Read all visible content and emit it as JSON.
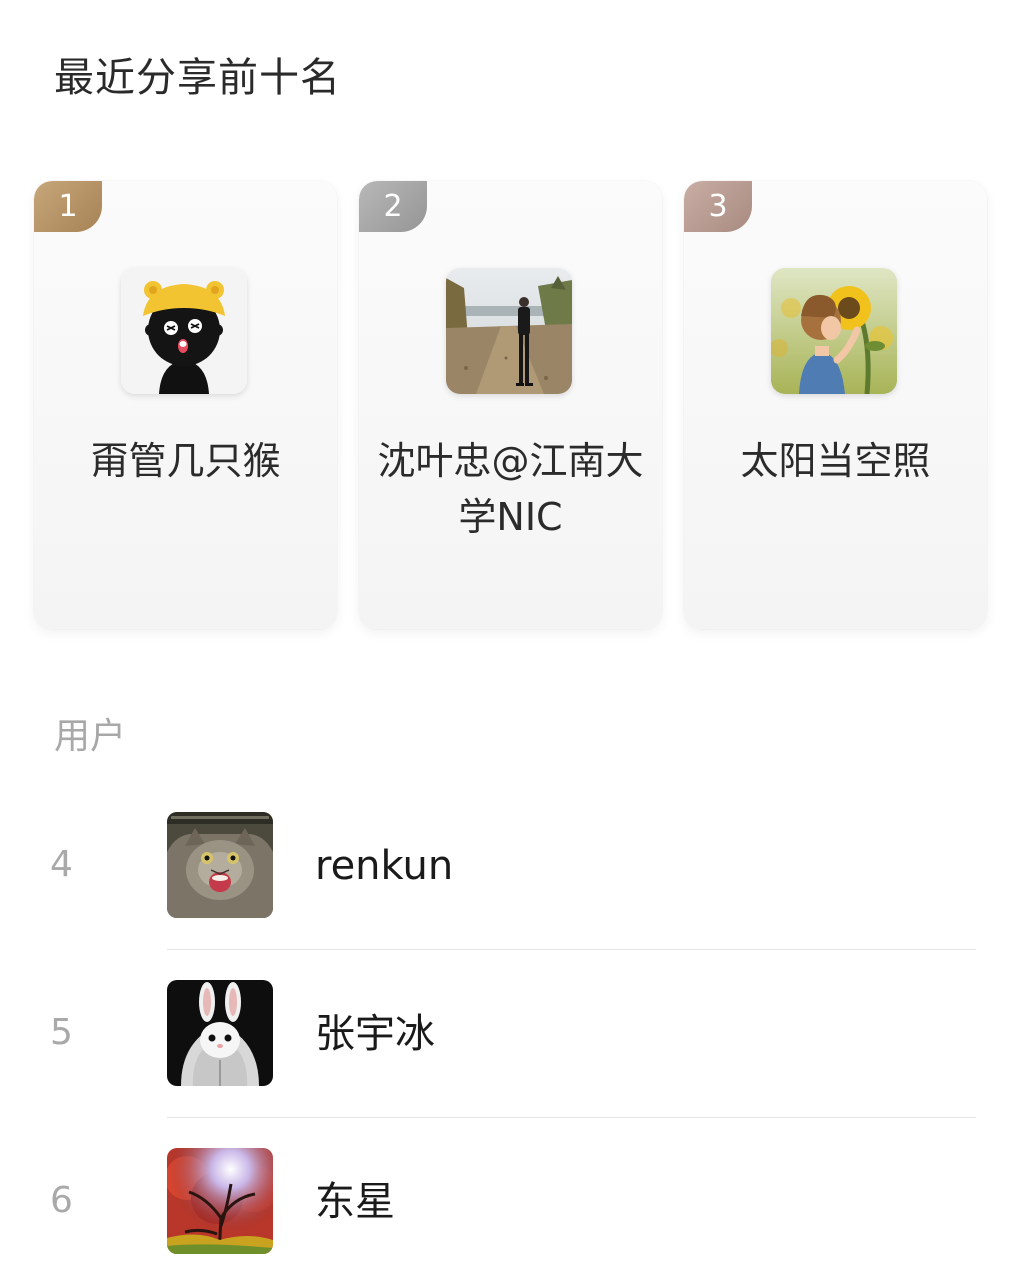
{
  "page": {
    "title": "最近分享前十名"
  },
  "top_three": [
    {
      "rank": "1",
      "name": "甭管几只猴",
      "avatar": "cartoon-black-creature-yellow-hat-avatar"
    },
    {
      "rank": "2",
      "name": "沈叶忠@江南大学NIC",
      "avatar": "man-standing-on-path-photo-avatar"
    },
    {
      "rank": "3",
      "name": "太阳当空照",
      "avatar": "child-with-sunflower-photo-avatar"
    }
  ],
  "section": {
    "label": "用户"
  },
  "users": [
    {
      "rank": "4",
      "name": "renkun",
      "avatar": "screaming-cat-avatar"
    },
    {
      "rank": "5",
      "name": "张宇冰",
      "avatar": "white-rabbit-hoodie-avatar"
    },
    {
      "rank": "6",
      "name": "东星",
      "avatar": "red-autumn-tree-avatar"
    }
  ],
  "colors": {
    "gold": "#b08d5f",
    "silver": "#a3a3a3",
    "bronze": "#b39589",
    "muted_text": "#a8a8a8"
  }
}
